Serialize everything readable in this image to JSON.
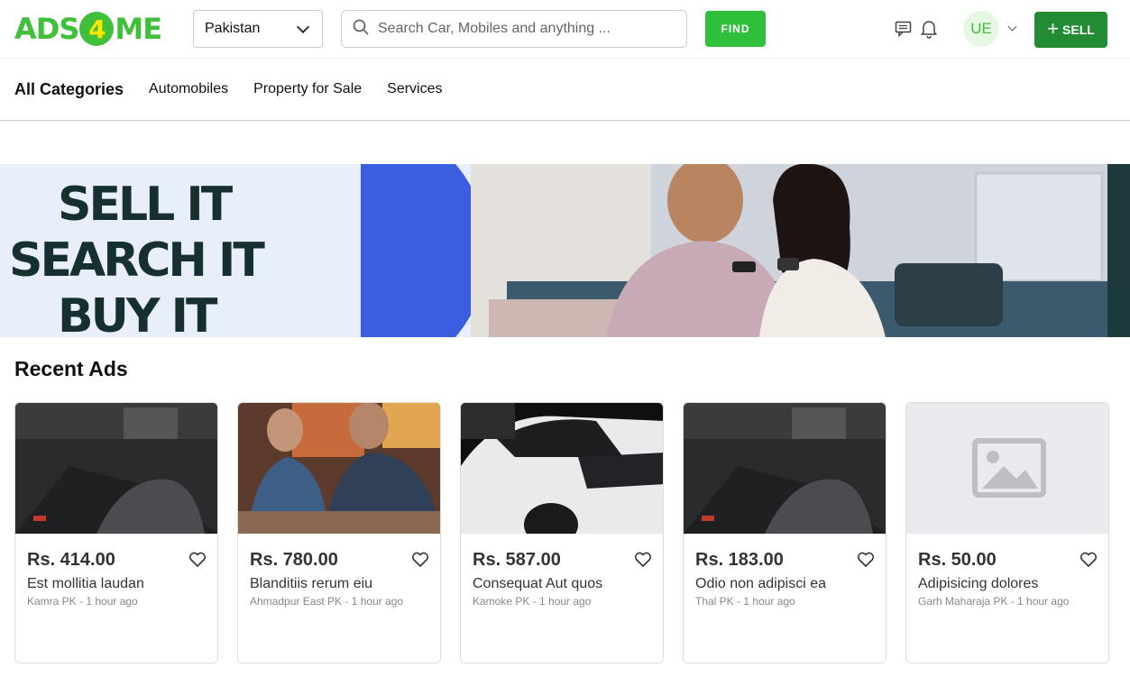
{
  "header": {
    "logo_text_left": "ADS",
    "logo_text_mid": "4",
    "logo_text_right": "ME",
    "country_selected": "Pakistan",
    "search_placeholder": "Search Car, Mobiles and anything ...",
    "find_label": "FIND",
    "avatar_initials": "UE",
    "sell_label": "SELL",
    "icons": [
      "message-icon",
      "bell-icon",
      "chevron-down-icon",
      "plus-icon",
      "search-icon"
    ],
    "brand_color": "#3fbf3a",
    "sell_color": "#228b34"
  },
  "categories": [
    {
      "label": "All Categories"
    },
    {
      "label": "Automobiles"
    },
    {
      "label": "Property for Sale"
    },
    {
      "label": "Services"
    }
  ],
  "banner": {
    "line1": "SELL IT",
    "line2": "SEARCH IT",
    "line3": "BUY IT"
  },
  "recent": {
    "title": "Recent Ads",
    "ads": [
      {
        "price": "Rs. 414.00",
        "title": "Est mollitia laudan",
        "meta": "Kamra PK - 1 hour ago",
        "image": "car-interior"
      },
      {
        "price": "Rs. 780.00",
        "title": "Blanditiis rerum eiu",
        "meta": "Ahmadpur East PK - 1 hour ago",
        "image": "workshop-people"
      },
      {
        "price": "Rs. 587.00",
        "title": "Consequat Aut quos",
        "meta": "Kamoke PK - 1 hour ago",
        "image": "white-suv"
      },
      {
        "price": "Rs. 183.00",
        "title": "Odio non adipisci ea",
        "meta": "Thal PK - 1 hour ago",
        "image": "car-interior"
      },
      {
        "price": "Rs. 50.00",
        "title": "Adipisicing dolores",
        "meta": "Garh Maharaja PK - 1 hour ago",
        "image": "placeholder"
      }
    ]
  }
}
